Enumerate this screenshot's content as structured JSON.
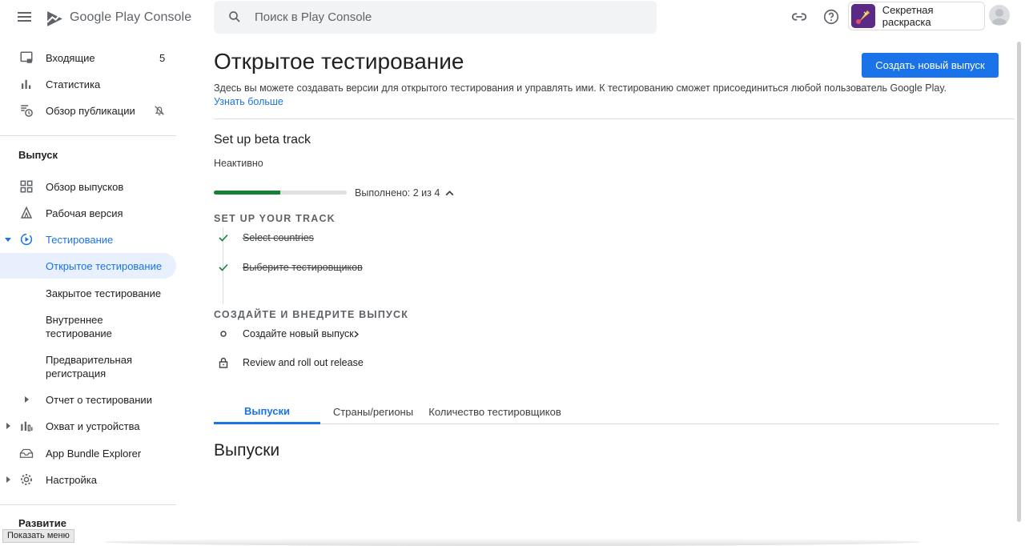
{
  "header": {
    "logo_text": "Google Play Console",
    "search_placeholder": "Поиск в Play Console",
    "app_name": "Секретная раскраска"
  },
  "sidebar": {
    "top_items": [
      {
        "label": "Входящие",
        "icon": "inbox-icon",
        "count": "5"
      },
      {
        "label": "Статистика",
        "icon": "bar-chart-icon"
      },
      {
        "label": "Обзор публикации",
        "icon": "publishing-history-icon",
        "right_icon": "notifications-off-icon"
      }
    ],
    "release_section": "Выпуск",
    "release_items": [
      {
        "label": "Обзор выпусков",
        "icon": "dashboard-icon"
      },
      {
        "label": "Рабочая версия",
        "icon": "production-icon"
      },
      {
        "label": "Тестирование",
        "icon": "testing-icon"
      }
    ],
    "testing_sub": [
      {
        "label": "Открытое тестирование"
      },
      {
        "label": "Закрытое тестирование"
      },
      {
        "label": "Внутреннее тестирование"
      },
      {
        "label": "Предварительная регистрация"
      }
    ],
    "test_report": "Отчет о тестировании",
    "lower_items": [
      {
        "label": "Охват и устройства",
        "icon": "reach-devices-icon"
      },
      {
        "label": "App Bundle Explorer",
        "icon": "bundle-explorer-icon"
      },
      {
        "label": "Настройка",
        "icon": "settings-icon"
      }
    ],
    "grow_section": "Развитие",
    "tooltip": "Показать меню"
  },
  "main": {
    "title": "Открытое тестирование",
    "create_button": "Создать новый выпуск",
    "description": "Здесь вы можете создавать версии для открытого тестирования и управлять ими. К тестированию сможет присоединиться любой пользователь Google Play.",
    "learn_more": "Узнать больше",
    "track_title": "Set up beta track",
    "track_status": "Неактивно",
    "progress_text": "Выполнено: 2 из 4",
    "progress_fraction": 0.5,
    "steps_section_1": "SET UP YOUR TRACK",
    "steps_1": [
      {
        "label": "Select countries",
        "status": "done"
      },
      {
        "label": "Выберите тестировщиков",
        "status": "done"
      }
    ],
    "steps_section_2": "Создайте и внедрите выпуск",
    "steps_2": [
      {
        "label": "Создайте новый выпуск",
        "status": "todo"
      },
      {
        "label": "Review and roll out release",
        "status": "locked"
      }
    ],
    "tabs": [
      "Выпуски",
      "Страны/регионы",
      "Количество тестировщиков"
    ],
    "active_tab": "Выпуски",
    "section_heading": "Выпуски"
  },
  "colors": {
    "accent": "#1a73e8",
    "progress": "#188038",
    "check": "#188038"
  }
}
